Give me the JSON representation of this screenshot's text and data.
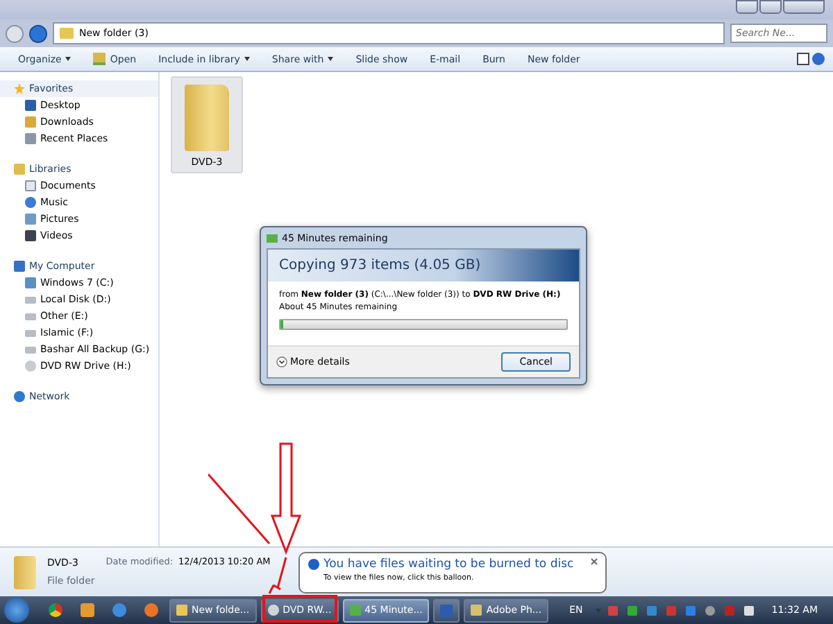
{
  "window": {
    "breadcrumb": [
      "New folder (3)"
    ],
    "search_placeholder": "Search Ne..."
  },
  "toolbar": [
    {
      "label": "Organize",
      "dropdown": true,
      "kind": "plain"
    },
    {
      "label": "Open",
      "dropdown": false,
      "kind": "open"
    },
    {
      "label": "Include in library",
      "dropdown": true,
      "kind": "plain"
    },
    {
      "label": "Share with",
      "dropdown": true,
      "kind": "plain"
    },
    {
      "label": "Slide show",
      "dropdown": false,
      "kind": "plain"
    },
    {
      "label": "E-mail",
      "dropdown": false,
      "kind": "plain"
    },
    {
      "label": "Burn",
      "dropdown": false,
      "kind": "plain"
    },
    {
      "label": "New folder",
      "dropdown": false,
      "kind": "plain"
    }
  ],
  "sidebar": {
    "groups": [
      {
        "label": "Favorites",
        "kind": "star",
        "children": [
          {
            "label": "Desktop",
            "kind": "desktop"
          },
          {
            "label": "Downloads",
            "kind": "download"
          },
          {
            "label": "Recent Places",
            "kind": "recent"
          }
        ]
      },
      {
        "label": "Libraries",
        "kind": "library",
        "children": [
          {
            "label": "Documents",
            "kind": "document"
          },
          {
            "label": "Music",
            "kind": "music"
          },
          {
            "label": "Pictures",
            "kind": "picture"
          },
          {
            "label": "Videos",
            "kind": "video"
          }
        ]
      },
      {
        "label": "My Computer",
        "kind": "computer",
        "children": [
          {
            "label": "Windows 7 (C:)",
            "kind": "system"
          },
          {
            "label": "Local Disk (D:)",
            "kind": "drive"
          },
          {
            "label": "Other (E:)",
            "kind": "drive"
          },
          {
            "label": "Islamic (F:)",
            "kind": "drive"
          },
          {
            "label": "Bashar All Backup (G:)",
            "kind": "drive"
          },
          {
            "label": "DVD RW Drive (H:)",
            "kind": "disc"
          }
        ]
      },
      {
        "label": "Network",
        "kind": "network"
      }
    ]
  },
  "files": [
    {
      "name": "DVD-3",
      "selected": true
    }
  ],
  "details": {
    "name": "DVD-3",
    "type": "File folder",
    "date_label": "Date modified:",
    "date_value": "12/4/2013 10:20 AM"
  },
  "dialog": {
    "title": "45 Minutes remaining",
    "heading": "Copying 973 items (4.05 GB)",
    "route": "from **New folder (3)** (C:\\...\\New folder (3))  to **DVD RW Drive (H:)**",
    "remaining": "About 45 Minutes remaining",
    "progress": {
      "level": 0.01
    },
    "more_details": "More details",
    "cancel": "Cancel"
  },
  "balloon": {
    "title": "You have files waiting to be burned to disc",
    "body": "To view the files now, click this balloon."
  },
  "taskbar": {
    "pinned": [
      {
        "kind": "chrome"
      },
      {
        "kind": "media"
      },
      {
        "kind": "ie"
      },
      {
        "kind": "firefox"
      }
    ],
    "buttons": [
      {
        "label": "New folde...",
        "kind": "folder",
        "active": false
      },
      {
        "label": "DVD RW...",
        "kind": "disc",
        "active": false
      },
      {
        "label": "45 Minute...",
        "kind": "copy",
        "active": true
      },
      {
        "kind": "word",
        "active": false
      },
      {
        "label": "Adobe Ph...",
        "kind": "photoshop",
        "active": false
      }
    ],
    "language": "EN",
    "clock": "11:32 AM"
  }
}
